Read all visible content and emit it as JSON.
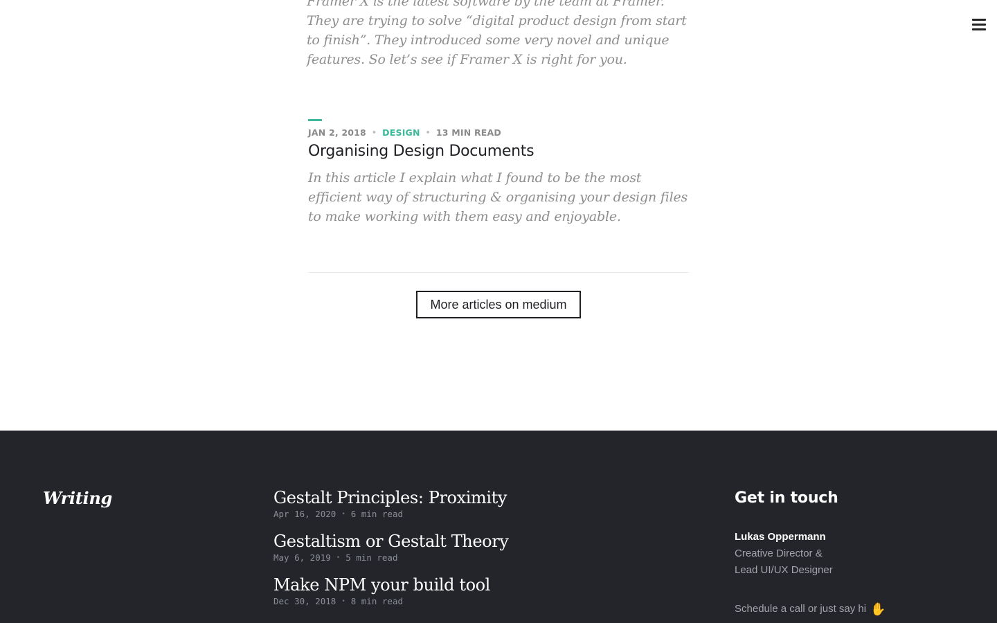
{
  "header": {
    "menu_icon": "hamburger-menu-icon"
  },
  "previous_article": {
    "excerpt": "Framer X is the latest software by the team at Framer. They are trying to solve “digital product design from start to finish”. They introduced some very novel and unique features. So let’s see if Framer X is right for you."
  },
  "article": {
    "date": "JAN 2, 2018",
    "separator": "•",
    "category": "DESIGN",
    "read_time": "13 MIN READ",
    "title": "Organising Design Documents",
    "excerpt": "In this article I explain what I found to be the most efficient way of structuring & organising your design files to make working with them easy and enjoyable."
  },
  "more_button": {
    "label": "More articles on medium"
  },
  "footer": {
    "writing_heading": "Writing",
    "posts": [
      {
        "title": "Gestalt Principles: Proximity",
        "date": "Apr 16, 2020",
        "separator": "•",
        "read_time": "6 min read"
      },
      {
        "title": "Gestaltism or Gestalt Theory",
        "date": "May 6, 2019",
        "separator": "•",
        "read_time": "5 min read"
      },
      {
        "title": "Make NPM your build tool",
        "date": "Dec 30, 2018",
        "separator": "•",
        "read_time": "8 min read"
      }
    ],
    "contact": {
      "heading": "Get in touch",
      "name": "Lukas Oppermann",
      "role_line1": "Creative Director &",
      "role_line2": "Lead UI/UX Designer",
      "cta": "Schedule a call or just say hi",
      "cta_icon": "waving-hand-icon"
    }
  },
  "colors": {
    "accent": "#3cb99a",
    "footer_bg": "#23252a",
    "text_dark": "#1f2024",
    "text_muted": "#8e8e8e"
  }
}
